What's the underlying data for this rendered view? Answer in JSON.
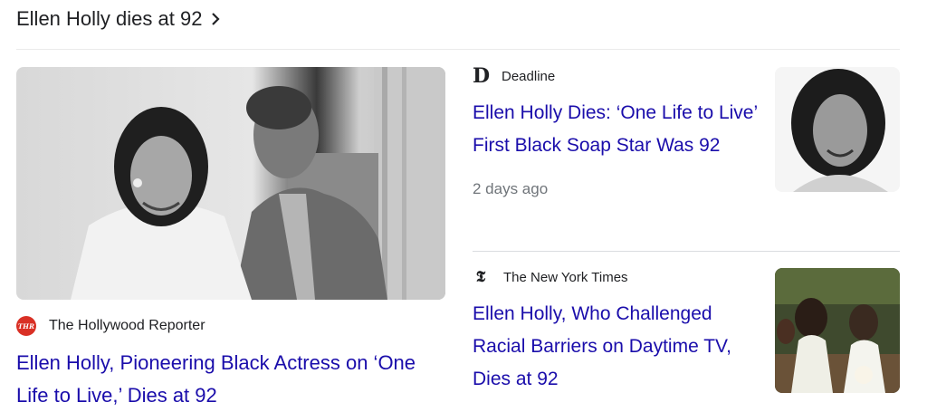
{
  "header": {
    "title": "Ellen Holly dies at 92"
  },
  "main_story": {
    "source": "The Hollywood Reporter",
    "source_logo_text": "THR",
    "headline": "Ellen Holly, Pioneering Black Actress on ‘One Life to Live,’ Dies at 92"
  },
  "side_stories": [
    {
      "source": "Deadline",
      "logo_text": "D",
      "headline": "Ellen Holly Dies: ‘One Life to Live’ First Black Soap Star Was 92",
      "time": "2 days ago"
    },
    {
      "source": "The New York Times",
      "logo_text": "𝕿",
      "headline": "Ellen Holly, Who Challenged Racial Barriers on Daytime TV, Dies at 92"
    }
  ],
  "colors": {
    "link": "#1a0dab",
    "meta": "#70757a",
    "text": "#202124",
    "thr_red": "#d93025"
  }
}
